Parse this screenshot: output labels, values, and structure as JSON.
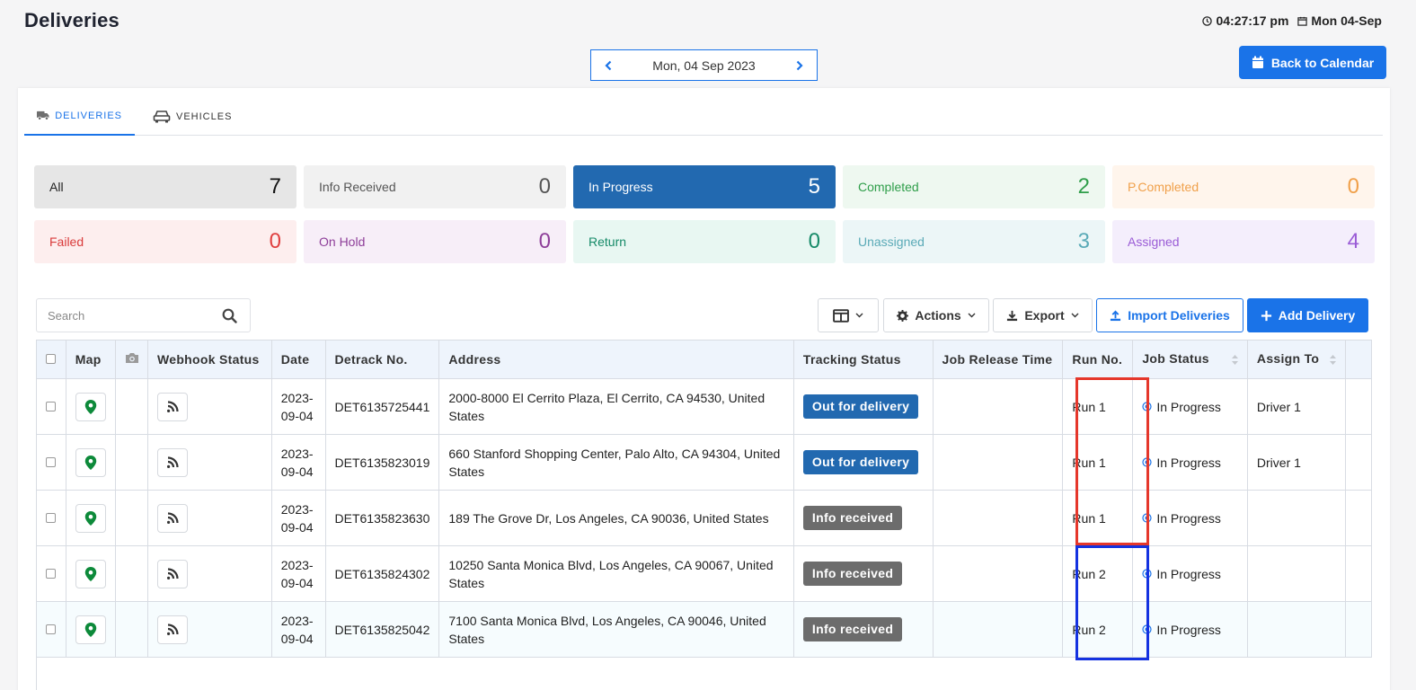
{
  "page": {
    "title": "Deliveries"
  },
  "clock": {
    "time": "04:27:17 pm",
    "date": "Mon 04-Sep"
  },
  "date_nav": {
    "label": "Mon, 04 Sep 2023"
  },
  "back_button": {
    "label": "Back to Calendar"
  },
  "tabs": [
    {
      "label": "DELIVERIES",
      "active": true,
      "icon": "truck-icon"
    },
    {
      "label": "VEHICLES",
      "active": false,
      "icon": "car-icon"
    }
  ],
  "stats": [
    {
      "label": "All",
      "count": "7",
      "bg": "#e6e6e6",
      "fg": "#222222",
      "num_fg": "#111111"
    },
    {
      "label": "Info Received",
      "count": "0",
      "bg": "#f1f1f1",
      "fg": "#555555",
      "num_fg": "#555555"
    },
    {
      "label": "In Progress",
      "count": "5",
      "bg": "#2269b0",
      "fg": "#ffffff",
      "num_fg": "#ffffff"
    },
    {
      "label": "Completed",
      "count": "2",
      "bg": "#eef8f0",
      "fg": "#2f9e4a",
      "num_fg": "#2f9e4a"
    },
    {
      "label": "P.Completed",
      "count": "0",
      "bg": "#fff5ec",
      "fg": "#f0a04a",
      "num_fg": "#f0a04a"
    },
    {
      "label": "Failed",
      "count": "0",
      "bg": "#fdeeee",
      "fg": "#d93b3b",
      "num_fg": "#e04040"
    },
    {
      "label": "On Hold",
      "count": "0",
      "bg": "#f7eef8",
      "fg": "#8e3e99",
      "num_fg": "#8e3e99"
    },
    {
      "label": "Return",
      "count": "0",
      "bg": "#e8f7f2",
      "fg": "#168a68",
      "num_fg": "#168a68"
    },
    {
      "label": "Unassigned",
      "count": "3",
      "bg": "#ecf6f7",
      "fg": "#5aaab7",
      "num_fg": "#5aaab7"
    },
    {
      "label": "Assigned",
      "count": "4",
      "bg": "#f4eefc",
      "fg": "#9a5cd6",
      "num_fg": "#9a5cd6"
    }
  ],
  "search": {
    "placeholder": "Search"
  },
  "toolbar": {
    "actions": "Actions",
    "export": "Export",
    "import": "Import Deliveries",
    "add": "Add Delivery"
  },
  "columns": [
    "Map",
    "Webhook Status",
    "Date",
    "Detrack No.",
    "Address",
    "Tracking Status",
    "Job Release Time",
    "Run No.",
    "Job Status",
    "Assign To"
  ],
  "rows": [
    {
      "date": [
        "2023-",
        "09-04"
      ],
      "detrack": "DET6135725441",
      "address": "2000-8000 El Cerrito Plaza, El Cerrito, CA 94530, United States",
      "tracking": "Out for delivery",
      "tracking_color": "#2269b0",
      "release": "",
      "run": "Run 1",
      "job_status": "In Progress",
      "assign": "Driver 1"
    },
    {
      "date": [
        "2023-",
        "09-04"
      ],
      "detrack": "DET6135823019",
      "address": "660 Stanford Shopping Center, Palo Alto, CA 94304, United States",
      "tracking": "Out for delivery",
      "tracking_color": "#2269b0",
      "release": "",
      "run": "Run 1",
      "job_status": "In Progress",
      "assign": "Driver 1"
    },
    {
      "date": [
        "2023-",
        "09-04"
      ],
      "detrack": "DET6135823630",
      "address": "189 The Grove Dr, Los Angeles, CA 90036, United States",
      "tracking": "Info received",
      "tracking_color": "#6c6c6c",
      "release": "",
      "run": "Run 1",
      "job_status": "In Progress",
      "assign": ""
    },
    {
      "date": [
        "2023-",
        "09-04"
      ],
      "detrack": "DET6135824302",
      "address": "10250 Santa Monica Blvd, Los Angeles, CA 90067, United States",
      "tracking": "Info received",
      "tracking_color": "#6c6c6c",
      "release": "",
      "run": "Run 2",
      "job_status": "In Progress",
      "assign": ""
    },
    {
      "date": [
        "2023-",
        "09-04"
      ],
      "detrack": "DET6135825042",
      "address": "7100 Santa Monica Blvd, Los Angeles, CA 90046, United States",
      "tracking": "Info received",
      "tracking_color": "#6c6c6c",
      "release": "",
      "run": "Run 2",
      "job_status": "In Progress",
      "assign": ""
    }
  ],
  "highlights": [
    {
      "name": "run-1-highlight",
      "color": "#e5372b"
    },
    {
      "name": "run-2-highlight",
      "color": "#1432e0"
    }
  ]
}
